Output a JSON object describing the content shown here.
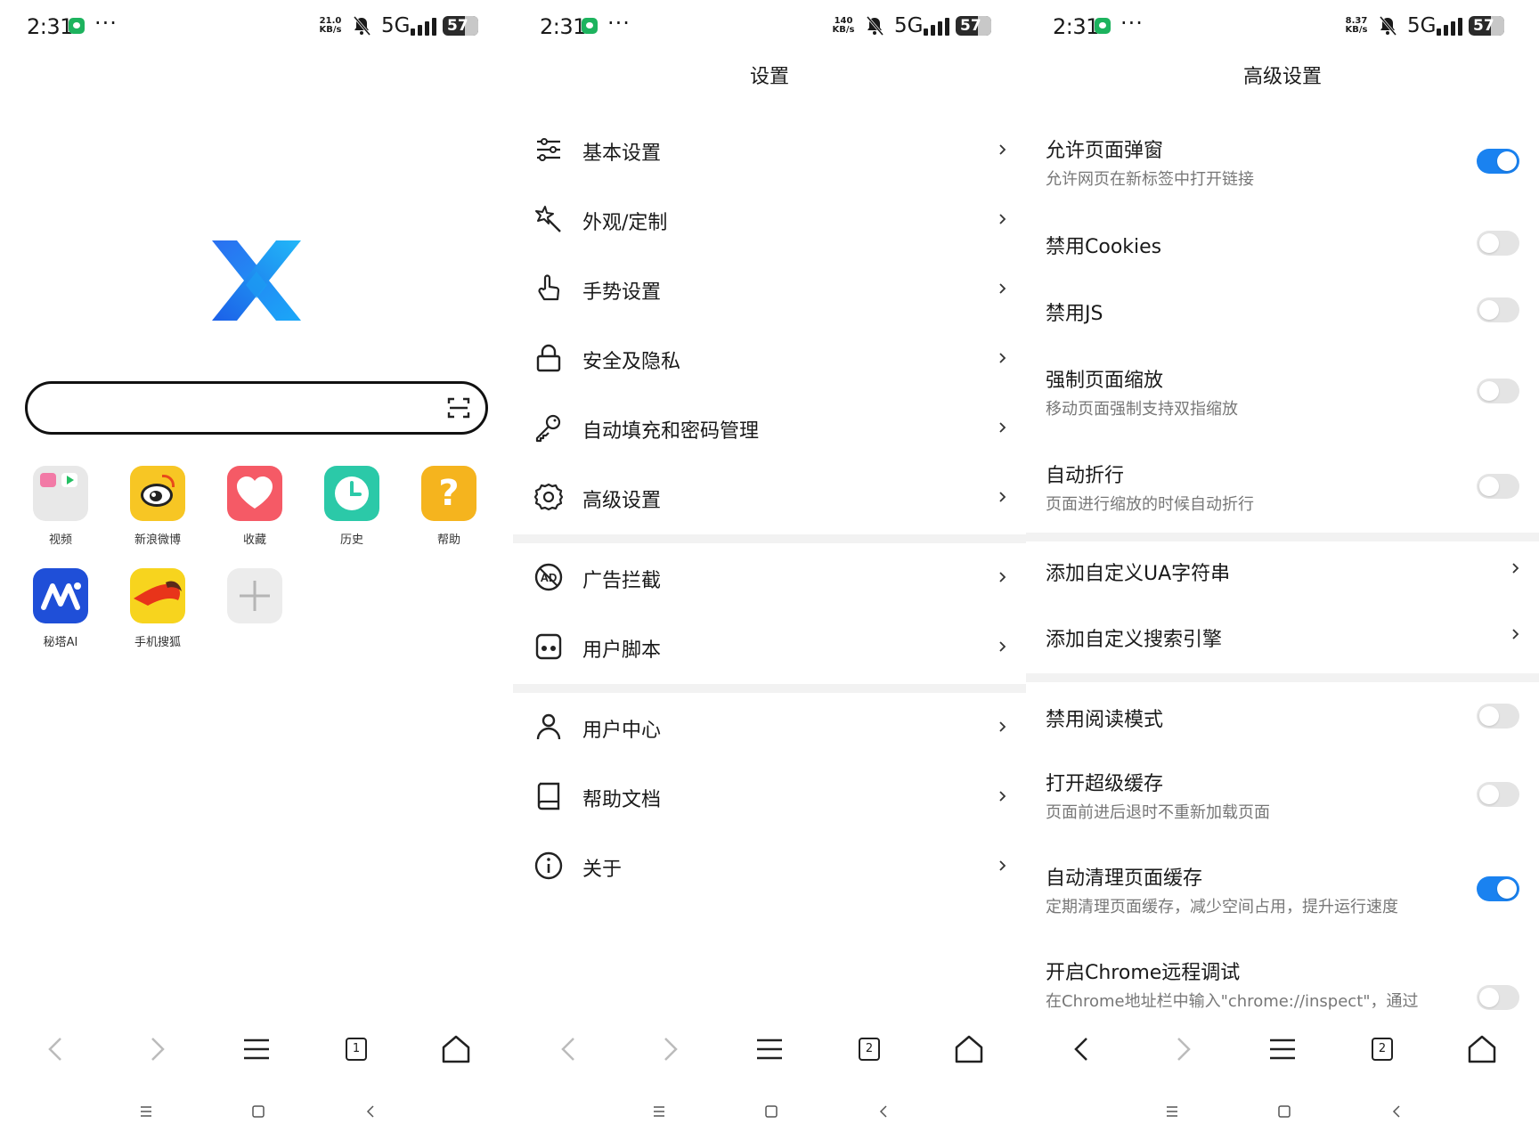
{
  "status_bars": [
    {
      "time": "2:31",
      "speed": "21.0 KB/s",
      "network": "5G",
      "battery": "57"
    },
    {
      "time": "2:31",
      "speed": "140 KB/s",
      "network": "5G",
      "battery": "57"
    },
    {
      "time": "2:31",
      "speed": "8.37 KB/s",
      "network": "5G",
      "battery": "57"
    }
  ],
  "colors": {
    "accent": "#1a82f0",
    "separator": "#f2f2f2"
  },
  "home": {
    "search_placeholder": "",
    "tab_count": "1",
    "shortcuts": [
      {
        "label": "视频",
        "icon": "video-folder-icon"
      },
      {
        "label": "新浪微博",
        "icon": "weibo-icon"
      },
      {
        "label": "收藏",
        "icon": "heart-icon"
      },
      {
        "label": "历史",
        "icon": "clock-icon"
      },
      {
        "label": "帮助",
        "icon": "question-icon"
      },
      {
        "label": "秘塔AI",
        "icon": "metaso-icon"
      },
      {
        "label": "手机搜狐",
        "icon": "sohu-icon"
      },
      {
        "label": "",
        "icon": "add-icon"
      }
    ]
  },
  "settings": {
    "title": "设置",
    "tab_count": "2",
    "items": [
      {
        "label": "基本设置",
        "icon": "sliders-icon"
      },
      {
        "label": "外观/定制",
        "icon": "magic-wand-icon"
      },
      {
        "label": "手势设置",
        "icon": "hand-pointer-icon"
      },
      {
        "label": "安全及隐私",
        "icon": "lock-icon"
      },
      {
        "label": "自动填充和密码管理",
        "icon": "key-icon"
      },
      {
        "label": "高级设置",
        "icon": "gear-icon"
      },
      {
        "label": "广告拦截",
        "icon": "ad-block-icon"
      },
      {
        "label": "用户脚本",
        "icon": "script-icon"
      },
      {
        "label": "用户中心",
        "icon": "user-icon"
      },
      {
        "label": "帮助文档",
        "icon": "book-icon"
      },
      {
        "label": "关于",
        "icon": "info-icon"
      }
    ]
  },
  "advanced": {
    "title": "高级设置",
    "tab_count": "2",
    "items": [
      {
        "title": "允许页面弹窗",
        "subtitle": "允许网页在新标签中打开链接",
        "enabled": true
      },
      {
        "title": "禁用Cookies",
        "subtitle": "",
        "enabled": false
      },
      {
        "title": "禁用JS",
        "subtitle": "",
        "enabled": false
      },
      {
        "title": "强制页面缩放",
        "subtitle": "移动页面强制支持双指缩放",
        "enabled": false
      },
      {
        "title": "自动折行",
        "subtitle": "页面进行缩放的时候自动折行",
        "enabled": false
      },
      {
        "title": "添加自定义UA字符串",
        "subtitle": "",
        "type": "link"
      },
      {
        "title": "添加自定义搜索引擎",
        "subtitle": "",
        "type": "link"
      },
      {
        "title": "禁用阅读模式",
        "subtitle": "",
        "enabled": false
      },
      {
        "title": "打开超级缓存",
        "subtitle": "页面前进后退时不重新加载页面",
        "enabled": false
      },
      {
        "title": "自动清理页面缓存",
        "subtitle": "定期清理页面缓存，减少空间占用，提升运行速度",
        "enabled": true
      },
      {
        "title": "开启Chrome远程调试",
        "subtitle": "在Chrome地址栏中输入\"chrome://inspect\"，通过",
        "enabled": false
      }
    ]
  }
}
